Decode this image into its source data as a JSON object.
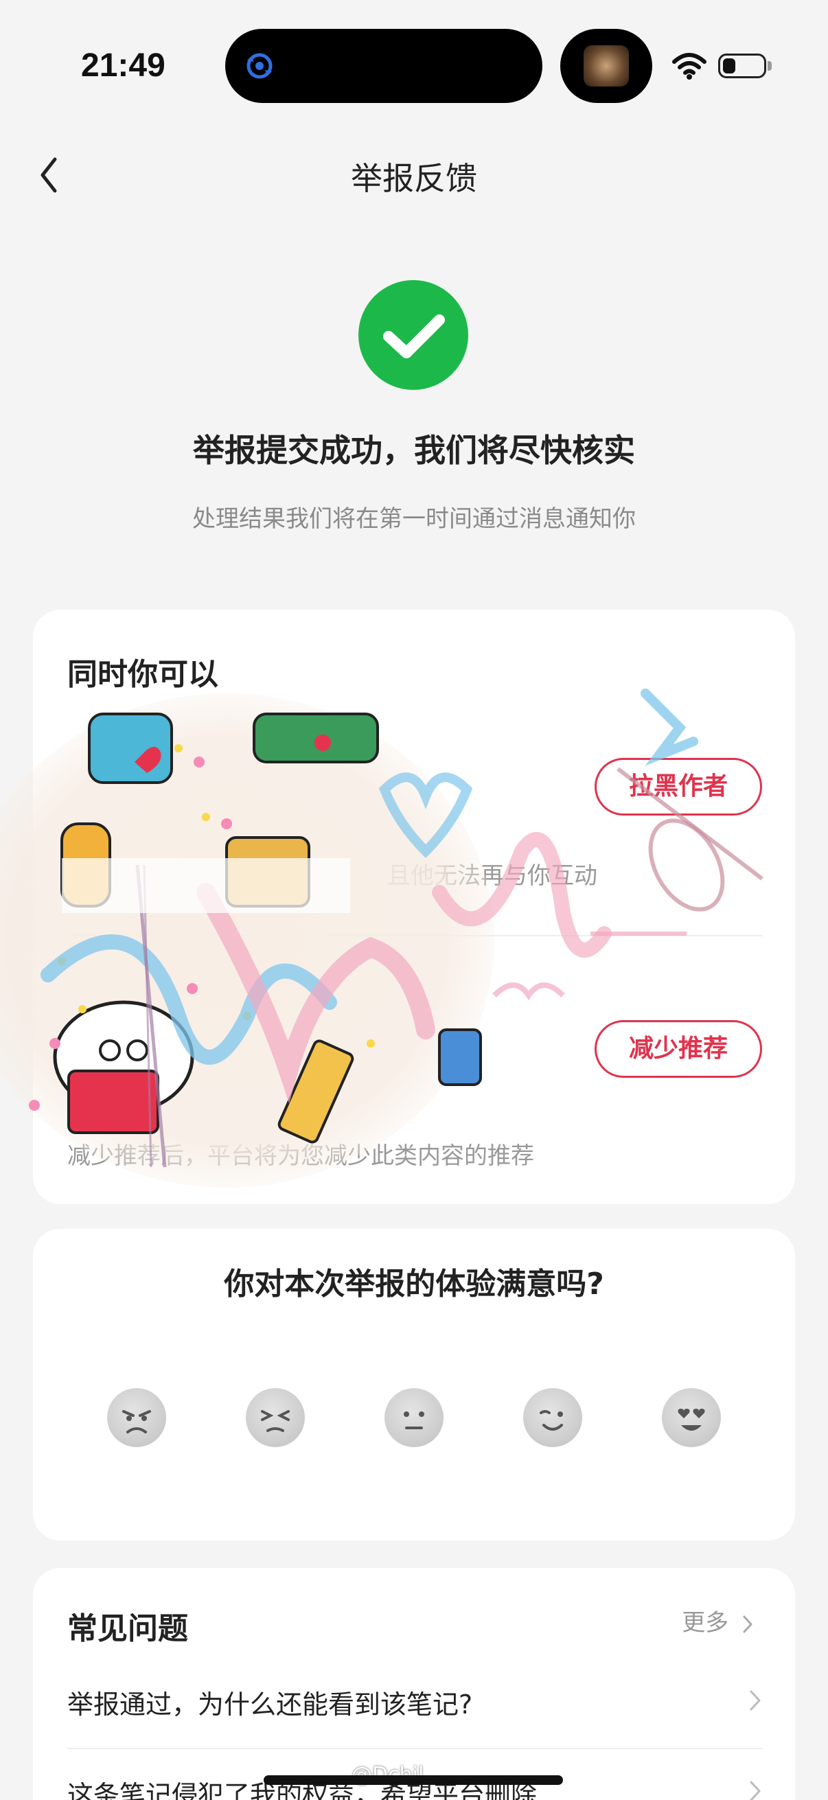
{
  "status_bar": {
    "time": "21:49"
  },
  "nav": {
    "title": "举报反馈"
  },
  "success": {
    "title": "举报提交成功，我们将尽快核实",
    "subtitle": "处理结果我们将在第一时间通过消息通知你"
  },
  "actions_card": {
    "heading": "同时你可以",
    "block": {
      "button_label": "拉黑作者",
      "desc": "且他无法再与你互动"
    },
    "reduce": {
      "button_label": "减少推荐",
      "desc": "减少推荐后，平台将为您减少此类内容的推荐"
    }
  },
  "rating_card": {
    "title": "你对本次举报的体验满意吗?",
    "faces": [
      {
        "icon": "angry-face-icon"
      },
      {
        "icon": "frustrated-face-icon"
      },
      {
        "icon": "neutral-face-icon"
      },
      {
        "icon": "smile-face-icon"
      },
      {
        "icon": "heart-eyes-face-icon"
      }
    ]
  },
  "faq_card": {
    "heading": "常见问题",
    "more_label": "更多",
    "items": [
      {
        "label": "举报通过，为什么还能看到该笔记?"
      },
      {
        "label": "这条笔记侵犯了我的权益，希望平台删除"
      }
    ]
  },
  "watermark": {
    "text": "Dchil",
    "footer_text": "@Dchil"
  },
  "colors": {
    "accent_red": "#e0334d",
    "success_green": "#1cb94a",
    "background": "#f4f4f4"
  }
}
